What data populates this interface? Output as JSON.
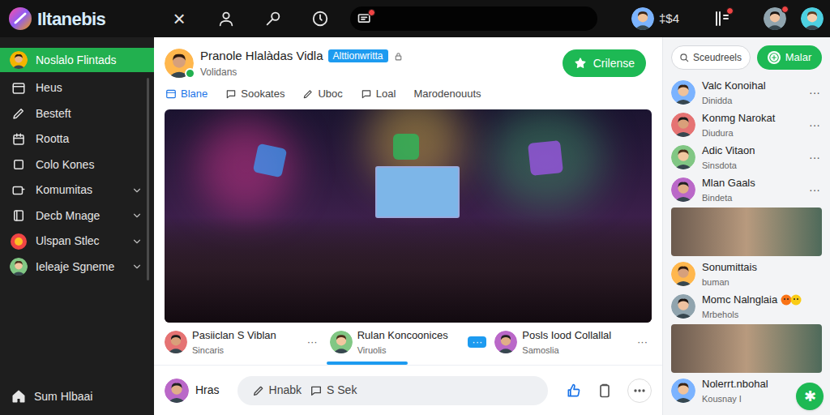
{
  "topbar": {
    "logo": "Iltanebis",
    "close": "×",
    "amount": "‡$4",
    "alerts": [
      {
        "unread": true
      },
      {
        "unread": true
      },
      {
        "unread": true
      }
    ]
  },
  "sidebar": {
    "items": [
      {
        "label": "Noslalo Flintads",
        "selected": true,
        "expandable": false,
        "kind": "avatar"
      },
      {
        "label": "Heus",
        "selected": false,
        "expandable": false,
        "kind": "icon"
      },
      {
        "label": "Besteft",
        "selected": false,
        "expandable": false,
        "kind": "icon"
      },
      {
        "label": "Rootta",
        "selected": false,
        "expandable": false,
        "kind": "icon"
      },
      {
        "label": "Colo Kones",
        "selected": false,
        "expandable": false,
        "kind": "icon"
      },
      {
        "label": "Komumitas",
        "selected": false,
        "expandable": true,
        "kind": "icon"
      },
      {
        "label": "Decb Mnage",
        "selected": false,
        "expandable": true,
        "kind": "icon"
      },
      {
        "label": "Ulspan Stlec",
        "selected": false,
        "expandable": true,
        "kind": "badge"
      },
      {
        "label": "Ieleaje Sgneme",
        "selected": false,
        "expandable": true,
        "kind": "avatar"
      }
    ],
    "footer": "Sum Hlbaai"
  },
  "post": {
    "author": "Pranole Hlalàdas Vidla",
    "tag": "Alttionwritta",
    "subtitle": "Volidans",
    "verified": true,
    "follow": "Crilense",
    "tabs": [
      {
        "label": "Blane",
        "selected": true
      },
      {
        "label": "Sookates",
        "selected": false
      },
      {
        "label": "Uboc",
        "selected": false
      },
      {
        "label": "Loal",
        "selected": false
      },
      {
        "label": "Marodenouuts",
        "selected": false
      }
    ],
    "people": [
      {
        "name": "Pasiiclan S Viblan",
        "sub": "Sincaris",
        "more": "···",
        "highlighted": false
      },
      {
        "name": "Rulan Koncoonices",
        "sub": "Viruolis",
        "more": "···",
        "highlighted": true
      },
      {
        "name": "Posls Iood Collallal",
        "sub": "Samoslia",
        "more": "···",
        "highlighted": false
      }
    ],
    "pager": [
      {
        "selected": false
      },
      {
        "selected": false
      },
      {
        "selected": true
      },
      {
        "selected": false
      },
      {
        "selected": false
      },
      {
        "selected": false
      }
    ]
  },
  "composer": {
    "user": "Hras",
    "actions": [
      "Hnabk",
      "S Sek"
    ]
  },
  "right": {
    "search": {
      "placeholder": "Sceudreels"
    },
    "button": "Malar",
    "items": [
      {
        "kind": "person",
        "name": "Valc Konoihal",
        "sub": "Dinidda",
        "more": "···",
        "reaction": false
      },
      {
        "kind": "person",
        "name": "Konmg Narokat",
        "sub": "Diudura",
        "more": "···",
        "reaction": false
      },
      {
        "kind": "person",
        "name": "Adic Vitaon",
        "sub": "Sinsdota",
        "more": "···",
        "reaction": false
      },
      {
        "kind": "person",
        "name": "Mlan Gaals",
        "sub": "Bindeta",
        "more": "···",
        "reaction": false
      },
      {
        "kind": "photo"
      },
      {
        "kind": "person",
        "name": "Sonumittais",
        "sub": "buman",
        "more": "",
        "reaction": false
      },
      {
        "kind": "person",
        "name": "Momc Nalnglaia",
        "sub": "Mrbehols",
        "more": "",
        "reaction": true
      },
      {
        "kind": "photo"
      },
      {
        "kind": "person",
        "name": "Nolerrt.nbohal",
        "sub": "Kousnay I",
        "more": "",
        "reaction": false
      }
    ],
    "fab": "✱"
  }
}
